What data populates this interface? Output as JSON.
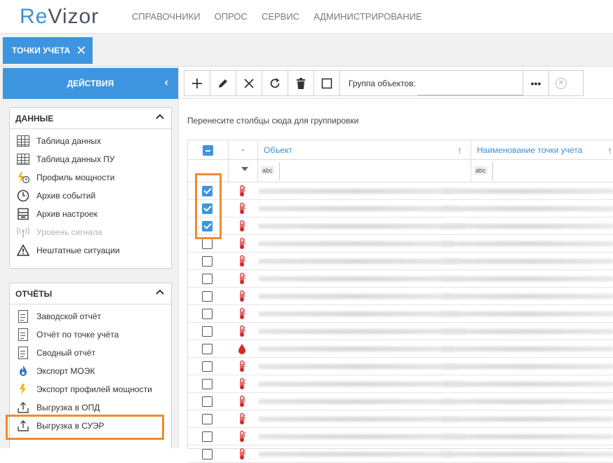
{
  "logo": {
    "part1": "Re",
    "part2": "Vizor"
  },
  "nav": [
    "Справочники",
    "Опрос",
    "Сервис",
    "Администрирование"
  ],
  "tab": {
    "label": "ТОЧКИ УЧЕТА",
    "close": "✕"
  },
  "actions": {
    "label": "ДЕЙСТВИЯ",
    "chevron": "‹"
  },
  "data_panel": {
    "title": "ДАННЫЕ",
    "items": [
      {
        "label": "Таблица данных",
        "icon": "table-icon"
      },
      {
        "label": "Таблица данных ПУ",
        "icon": "table-icon"
      },
      {
        "label": "Профиль мощности",
        "icon": "lightning-clock-icon"
      },
      {
        "label": "Архив событий",
        "icon": "clock-icon"
      },
      {
        "label": "Архив настроек",
        "icon": "settings-archive-icon"
      },
      {
        "label": "Уровень сигнала",
        "icon": "signal-icon",
        "disabled": true
      },
      {
        "label": "Нештатные ситуации",
        "icon": "warning-icon"
      }
    ]
  },
  "reports_panel": {
    "title": "ОТЧЁТЫ",
    "items": [
      {
        "label": "Заводской отчёт",
        "icon": "document-icon"
      },
      {
        "label": "Отчёт по точке учёта",
        "icon": "document-icon"
      },
      {
        "label": "Сводный отчёт",
        "icon": "document-icon"
      },
      {
        "label": "Экспорт МОЭК",
        "icon": "moek-flame-icon"
      },
      {
        "label": "Экспорт профилей мощности",
        "icon": "lightning-icon"
      },
      {
        "label": "Выгрузка в ОПД",
        "icon": "upload-icon"
      },
      {
        "label": "Выгрузка в СУЭР",
        "icon": "upload-icon"
      }
    ]
  },
  "toolbar": {
    "group_label": "Группа объектов:",
    "more": "•••",
    "clear": "✕",
    "icons": [
      "add-icon",
      "edit-icon",
      "delete-icon",
      "refresh-icon",
      "trash-icon",
      "select-box-icon"
    ]
  },
  "grid": {
    "group_hint": "Перенесите столбцы сюда для группировки",
    "columns": [
      "",
      "-",
      "Объект",
      "Наименование точки учета"
    ],
    "sort_glyph": "↑",
    "filter_glyph": "abc",
    "rows": [
      {
        "checked": true,
        "type": "thermometer"
      },
      {
        "checked": true,
        "type": "thermometer"
      },
      {
        "checked": true,
        "type": "thermometer"
      },
      {
        "checked": false,
        "type": "thermometer"
      },
      {
        "checked": false,
        "type": "thermometer"
      },
      {
        "checked": false,
        "type": "thermometer"
      },
      {
        "checked": false,
        "type": "thermometer"
      },
      {
        "checked": false,
        "type": "thermometer"
      },
      {
        "checked": false,
        "type": "thermometer"
      },
      {
        "checked": false,
        "type": "water-drop"
      },
      {
        "checked": false,
        "type": "thermometer"
      },
      {
        "checked": false,
        "type": "thermometer"
      },
      {
        "checked": false,
        "type": "thermometer"
      },
      {
        "checked": false,
        "type": "thermometer"
      },
      {
        "checked": false,
        "type": "thermometer"
      },
      {
        "checked": false,
        "type": "thermometer"
      }
    ]
  },
  "colors": {
    "accent": "#3d95e0",
    "highlight": "#f28a2e",
    "thermo": "#d9262c"
  }
}
